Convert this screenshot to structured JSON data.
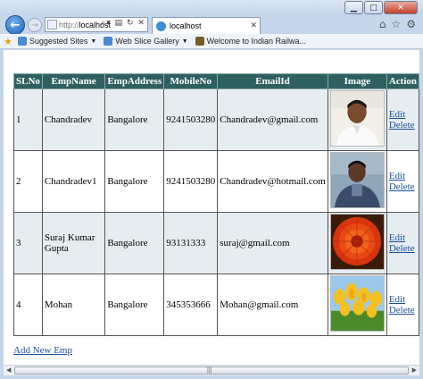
{
  "browser": {
    "address_prefix": "http://",
    "address_host": "localhost",
    "tab_title": "localhost",
    "favorites": [
      {
        "label": "Suggested Sites"
      },
      {
        "label": "Web Slice Gallery"
      },
      {
        "label": "Welcome to Indian Railwa..."
      }
    ]
  },
  "table": {
    "headers": [
      "SLNo",
      "EmpName",
      "EmpAddress",
      "MobileNo",
      "EmailId",
      "Image",
      "Action"
    ],
    "rows": [
      {
        "slno": "1",
        "name": "Chandradev",
        "address": "Bangalore",
        "mobile": "9241503280",
        "email": "Chandradev@gmail.com",
        "image": "portrait-man-light",
        "edit": "Edit",
        "delete": "Delete"
      },
      {
        "slno": "2",
        "name": "Chandradev1",
        "address": "Bangalore",
        "mobile": "9241503280",
        "email": "Chandradev@hotmail.com",
        "image": "portrait-man-dark",
        "edit": "Edit",
        "delete": "Delete"
      },
      {
        "slno": "3",
        "name": "Suraj Kumar Gupta",
        "address": "Bangalore",
        "mobile": "93131333",
        "email": "suraj@gmail.com",
        "image": "red-flower",
        "edit": "Edit",
        "delete": "Delete"
      },
      {
        "slno": "4",
        "name": "Mohan",
        "address": "Bangalore",
        "mobile": "345353666",
        "email": "Mohan@gmail.com",
        "image": "yellow-tulips",
        "edit": "Edit",
        "delete": "Delete"
      }
    ]
  },
  "add_link": "Add New Emp",
  "colors": {
    "header_bg": "#2e6060",
    "link": "#1a4f9c",
    "odd_row": "#e6edf0"
  }
}
